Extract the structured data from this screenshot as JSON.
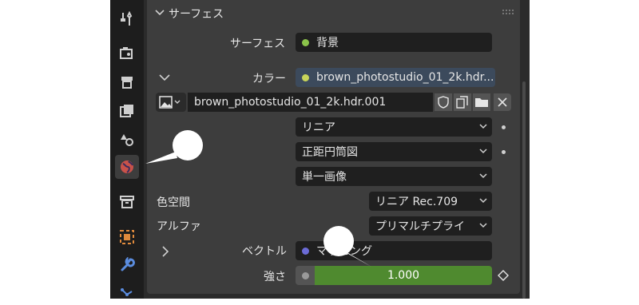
{
  "panel": {
    "title": "サーフェス"
  },
  "surface": {
    "label": "サーフェス",
    "value": "背景",
    "dot_color": "#8bc34a"
  },
  "color": {
    "label": "カラー",
    "value": "brown_photostudio_01_2k.hdr....",
    "dot_color": "#c8d45a"
  },
  "image": {
    "name": "brown_photostudio_01_2k.hdr.001"
  },
  "dropdowns": {
    "interpolation": "リニア",
    "projection": "正距円筒図",
    "source": "単一画像"
  },
  "color_space": {
    "label": "色空間",
    "value": "リニア Rec.709"
  },
  "alpha": {
    "label": "アルファ",
    "value": "プリマルチプライ"
  },
  "vector": {
    "label": "ベクトル",
    "value": "マッピング",
    "dot_color": "#6b6bd6"
  },
  "strength": {
    "label": "強さ",
    "value": "1.000"
  },
  "icons": {
    "sidebar": [
      "tool-icon",
      "render-icon",
      "output-icon",
      "view-layer-icon",
      "scene-icon",
      "world-icon",
      "collection-icon",
      "object-icon",
      "modifier-icon",
      "particles-icon"
    ],
    "active": "world-icon"
  },
  "colors": {
    "slider_green": "#4f8a2f",
    "panel_bg": "#3d3d3d",
    "field_bg": "#1f1f1f",
    "highlight_blue": "#3c4a5c"
  }
}
